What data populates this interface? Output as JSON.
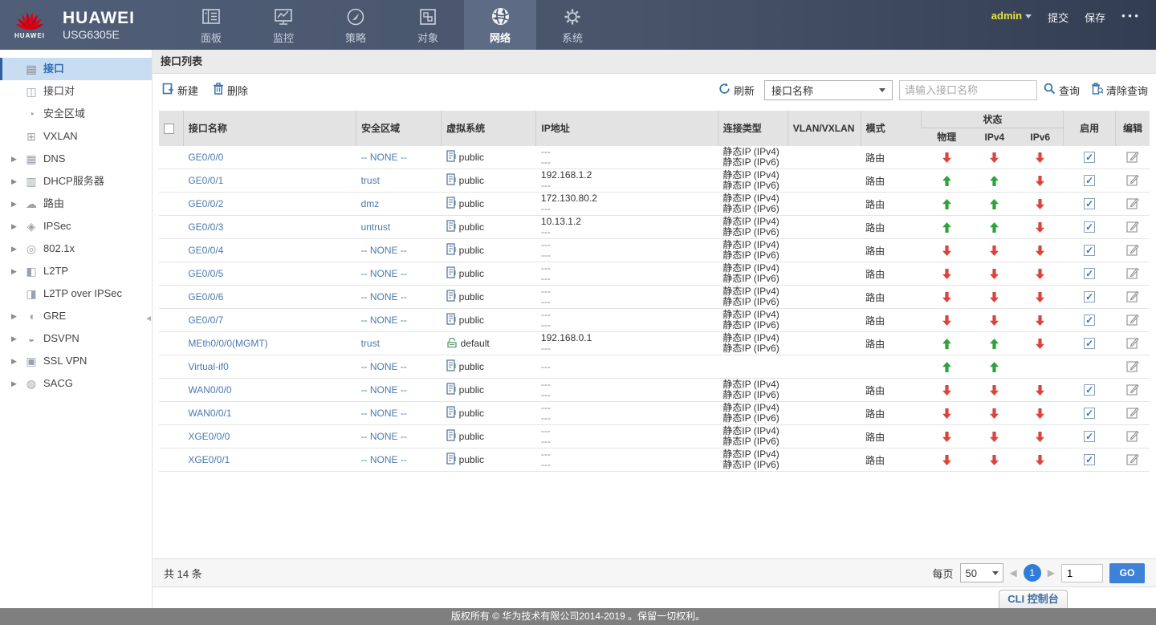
{
  "header": {
    "brand": {
      "logo_word": "HUAWEI",
      "name": "HUAWEI",
      "model": "USG6305E"
    },
    "tabs": [
      {
        "id": "dashboard",
        "label": "面板",
        "icon": "dashboard-icon",
        "active": false
      },
      {
        "id": "monitor",
        "label": "监控",
        "icon": "monitor-icon",
        "active": false
      },
      {
        "id": "policy",
        "label": "策略",
        "icon": "policy-icon",
        "active": false
      },
      {
        "id": "object",
        "label": "对象",
        "icon": "object-icon",
        "active": false
      },
      {
        "id": "network",
        "label": "网络",
        "icon": "network-icon",
        "active": true
      },
      {
        "id": "system",
        "label": "系统",
        "icon": "system-icon",
        "active": false
      }
    ],
    "user": "admin",
    "commit_label": "提交",
    "save_label": "保存",
    "more_label": "• • •"
  },
  "sidebar": {
    "items": [
      {
        "id": "interface",
        "label": "接口",
        "glyph": "▤",
        "expandable": false,
        "selected": true
      },
      {
        "id": "interface-pair",
        "label": "接口对",
        "glyph": "◫",
        "expandable": false,
        "selected": false
      },
      {
        "id": "security-zone",
        "label": "安全区域",
        "glyph": "◔",
        "expandable": false,
        "selected": false
      },
      {
        "id": "vxlan",
        "label": "VXLAN",
        "glyph": "⊞",
        "expandable": false,
        "selected": false
      },
      {
        "id": "dns",
        "label": "DNS",
        "glyph": "▦",
        "expandable": true,
        "selected": false
      },
      {
        "id": "dhcp-server",
        "label": "DHCP服务器",
        "glyph": "▥",
        "expandable": true,
        "selected": false
      },
      {
        "id": "routing",
        "label": "路由",
        "glyph": "☁",
        "expandable": true,
        "selected": false
      },
      {
        "id": "ipsec",
        "label": "IPSec",
        "glyph": "◈",
        "expandable": true,
        "selected": false
      },
      {
        "id": "dot1x",
        "label": "802.1x",
        "glyph": "◎",
        "expandable": true,
        "selected": false
      },
      {
        "id": "l2tp",
        "label": "L2TP",
        "glyph": "◧",
        "expandable": true,
        "selected": false
      },
      {
        "id": "l2tp-over-ipsec",
        "label": "L2TP over IPSec",
        "glyph": "◨",
        "expandable": false,
        "selected": false
      },
      {
        "id": "gre",
        "label": "GRE",
        "glyph": "◖",
        "expandable": true,
        "selected": false
      },
      {
        "id": "dsvpn",
        "label": "DSVPN",
        "glyph": "◒",
        "expandable": true,
        "selected": false
      },
      {
        "id": "ssl-vpn",
        "label": "SSL VPN",
        "glyph": "▣",
        "expandable": true,
        "selected": false
      },
      {
        "id": "sacg",
        "label": "SACG",
        "glyph": "◍",
        "expandable": true,
        "selected": false
      }
    ]
  },
  "main": {
    "title": "接口列表",
    "toolbar": {
      "new_label": "新建",
      "delete_label": "删除",
      "refresh_label": "刷新",
      "filter_field_value": "接口名称",
      "search_placeholder": "请输入接口名称",
      "query_label": "查询",
      "clear_query_label": "清除查询"
    },
    "table": {
      "columns": {
        "name": "接口名称",
        "zone": "安全区域",
        "vsys": "虚拟系统",
        "ip": "IP地址",
        "conn": "连接类型",
        "vlan": "VLAN/VXLAN",
        "mode": "模式",
        "status": "状态",
        "phy": "物理",
        "ipv4": "IPv4",
        "ipv6": "IPv6",
        "enable": "启用",
        "edit": "编辑"
      },
      "rows": [
        {
          "name": "GE0/0/0",
          "zone": "-- NONE --",
          "vsys": "public",
          "vsys_icon": "public",
          "ip": [
            "---",
            "---"
          ],
          "conn": [
            "静态IP (IPv4)",
            "静态IP (IPv6)"
          ],
          "vlan": "",
          "mode": "路由",
          "phy": "down",
          "ipv4": "down",
          "ipv6": "down",
          "enable": true
        },
        {
          "name": "GE0/0/1",
          "zone": "trust",
          "vsys": "public",
          "vsys_icon": "public",
          "ip": [
            "192.168.1.2",
            "---"
          ],
          "conn": [
            "静态IP (IPv4)",
            "静态IP (IPv6)"
          ],
          "vlan": "",
          "mode": "路由",
          "phy": "up",
          "ipv4": "up",
          "ipv6": "down",
          "enable": true
        },
        {
          "name": "GE0/0/2",
          "zone": "dmz",
          "vsys": "public",
          "vsys_icon": "public",
          "ip": [
            "172.130.80.2",
            "---"
          ],
          "conn": [
            "静态IP (IPv4)",
            "静态IP (IPv6)"
          ],
          "vlan": "",
          "mode": "路由",
          "phy": "up",
          "ipv4": "up",
          "ipv6": "down",
          "enable": true
        },
        {
          "name": "GE0/0/3",
          "zone": "untrust",
          "vsys": "public",
          "vsys_icon": "public",
          "ip": [
            "10.13.1.2",
            "---"
          ],
          "conn": [
            "静态IP (IPv4)",
            "静态IP (IPv6)"
          ],
          "vlan": "",
          "mode": "路由",
          "phy": "up",
          "ipv4": "up",
          "ipv6": "down",
          "enable": true
        },
        {
          "name": "GE0/0/4",
          "zone": "-- NONE --",
          "vsys": "public",
          "vsys_icon": "public",
          "ip": [
            "---",
            "---"
          ],
          "conn": [
            "静态IP (IPv4)",
            "静态IP (IPv6)"
          ],
          "vlan": "",
          "mode": "路由",
          "phy": "down",
          "ipv4": "down",
          "ipv6": "down",
          "enable": true
        },
        {
          "name": "GE0/0/5",
          "zone": "-- NONE --",
          "vsys": "public",
          "vsys_icon": "public",
          "ip": [
            "---",
            "---"
          ],
          "conn": [
            "静态IP (IPv4)",
            "静态IP (IPv6)"
          ],
          "vlan": "",
          "mode": "路由",
          "phy": "down",
          "ipv4": "down",
          "ipv6": "down",
          "enable": true
        },
        {
          "name": "GE0/0/6",
          "zone": "-- NONE --",
          "vsys": "public",
          "vsys_icon": "public",
          "ip": [
            "---",
            "---"
          ],
          "conn": [
            "静态IP (IPv4)",
            "静态IP (IPv6)"
          ],
          "vlan": "",
          "mode": "路由",
          "phy": "down",
          "ipv4": "down",
          "ipv6": "down",
          "enable": true
        },
        {
          "name": "GE0/0/7",
          "zone": "-- NONE --",
          "vsys": "public",
          "vsys_icon": "public",
          "ip": [
            "---",
            "---"
          ],
          "conn": [
            "静态IP (IPv4)",
            "静态IP (IPv6)"
          ],
          "vlan": "",
          "mode": "路由",
          "phy": "down",
          "ipv4": "down",
          "ipv6": "down",
          "enable": true
        },
        {
          "name": "MEth0/0/0(MGMT)",
          "zone": "trust",
          "vsys": "default",
          "vsys_icon": "default",
          "ip": [
            "192.168.0.1",
            "---"
          ],
          "conn": [
            "静态IP (IPv4)",
            "静态IP (IPv6)"
          ],
          "vlan": "",
          "mode": "路由",
          "phy": "up",
          "ipv4": "up",
          "ipv6": "down",
          "enable": true
        },
        {
          "name": "Virtual-if0",
          "zone": "-- NONE --",
          "vsys": "public",
          "vsys_icon": "public",
          "ip": [
            "---"
          ],
          "conn": [],
          "vlan": "",
          "mode": "",
          "phy": "up",
          "ipv4": "up",
          "ipv6": "",
          "enable": false
        },
        {
          "name": "WAN0/0/0",
          "zone": "-- NONE --",
          "vsys": "public",
          "vsys_icon": "public",
          "ip": [
            "---",
            "---"
          ],
          "conn": [
            "静态IP (IPv4)",
            "静态IP (IPv6)"
          ],
          "vlan": "",
          "mode": "路由",
          "phy": "down",
          "ipv4": "down",
          "ipv6": "down",
          "enable": true
        },
        {
          "name": "WAN0/0/1",
          "zone": "-- NONE --",
          "vsys": "public",
          "vsys_icon": "public",
          "ip": [
            "---",
            "---"
          ],
          "conn": [
            "静态IP (IPv4)",
            "静态IP (IPv6)"
          ],
          "vlan": "",
          "mode": "路由",
          "phy": "down",
          "ipv4": "down",
          "ipv6": "down",
          "enable": true
        },
        {
          "name": "XGE0/0/0",
          "zone": "-- NONE --",
          "vsys": "public",
          "vsys_icon": "public",
          "ip": [
            "---",
            "---"
          ],
          "conn": [
            "静态IP (IPv4)",
            "静态IP (IPv6)"
          ],
          "vlan": "",
          "mode": "路由",
          "phy": "down",
          "ipv4": "down",
          "ipv6": "down",
          "enable": true
        },
        {
          "name": "XGE0/0/1",
          "zone": "-- NONE --",
          "vsys": "public",
          "vsys_icon": "public",
          "ip": [
            "---",
            "---"
          ],
          "conn": [
            "静态IP (IPv4)",
            "静态IP (IPv6)"
          ],
          "vlan": "",
          "mode": "路由",
          "phy": "down",
          "ipv4": "down",
          "ipv6": "down",
          "enable": true
        }
      ]
    },
    "pagination": {
      "total": "共 14 条",
      "per_page_label": "每页",
      "per_page_value": "50",
      "current_page": "1",
      "goto_value": "1",
      "go_label": "GO"
    }
  },
  "footer": {
    "cli_label": "CLI 控制台",
    "copyright": "版权所有 © 华为技术有限公司2014-2019 。保留一切权利。"
  },
  "colors": {
    "topbar_left": "#505e79",
    "topbar_right": "#333d52",
    "active_tab_bg": "#5d6b85",
    "admin_yellow": "#e6e43c",
    "selected_item_bg": "#c9ddf2",
    "link_blue": "#4a7ab0",
    "icon_blue": "#3a74ad",
    "status_up_green": "#2fa33b",
    "status_down_red": "#d9453c",
    "pagination_blue": "#2e7ed8",
    "footer_gray": "#7f7f7f"
  }
}
